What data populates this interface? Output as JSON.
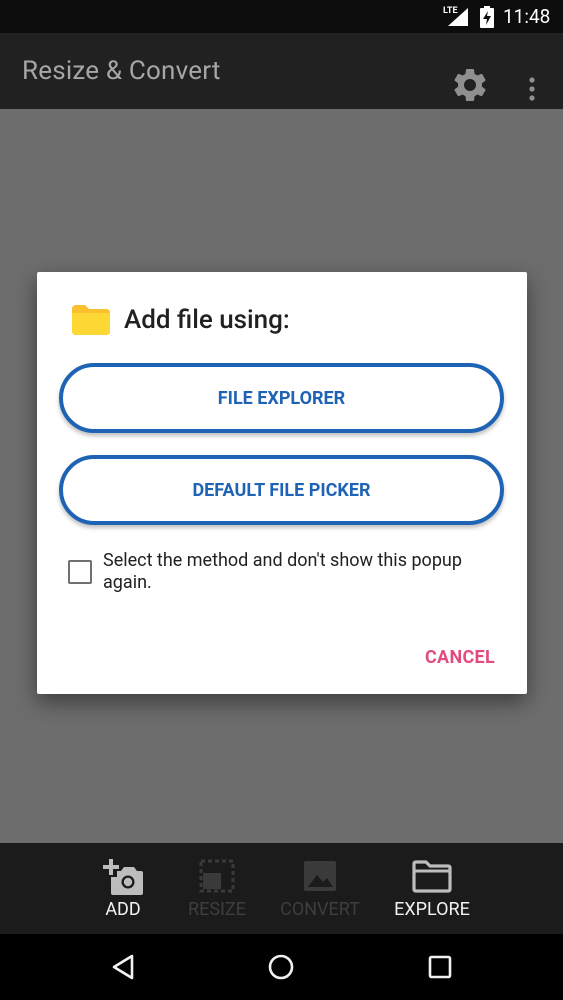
{
  "status_bar": {
    "network": "LTE",
    "time": "11:48"
  },
  "app_bar": {
    "title": "Resize & Convert",
    "icons": [
      "gear-icon",
      "more-vert-icon"
    ]
  },
  "dialog": {
    "title": "Add file using:",
    "title_icon": "folder-icon",
    "buttons": {
      "file_explorer": "FILE EXPLORER",
      "default_picker": "DEFAULT FILE PICKER"
    },
    "checkbox": {
      "label": "Select the method and don't show this popup again.",
      "checked": false
    },
    "cancel": "CANCEL",
    "colors": {
      "primary": "#1f63b5",
      "accent": "#e4497f",
      "folder": "#fbc02d"
    }
  },
  "bottom_nav": {
    "items": [
      {
        "label": "ADD",
        "icon": "add-photo-icon",
        "enabled": true
      },
      {
        "label": "RESIZE",
        "icon": "resize-icon",
        "enabled": false
      },
      {
        "label": "CONVERT",
        "icon": "image-icon",
        "enabled": false
      },
      {
        "label": "EXPLORE",
        "icon": "folder-outline-icon",
        "enabled": true
      }
    ]
  },
  "system_nav": {
    "icons": [
      "back-icon",
      "home-icon",
      "recents-icon"
    ]
  }
}
